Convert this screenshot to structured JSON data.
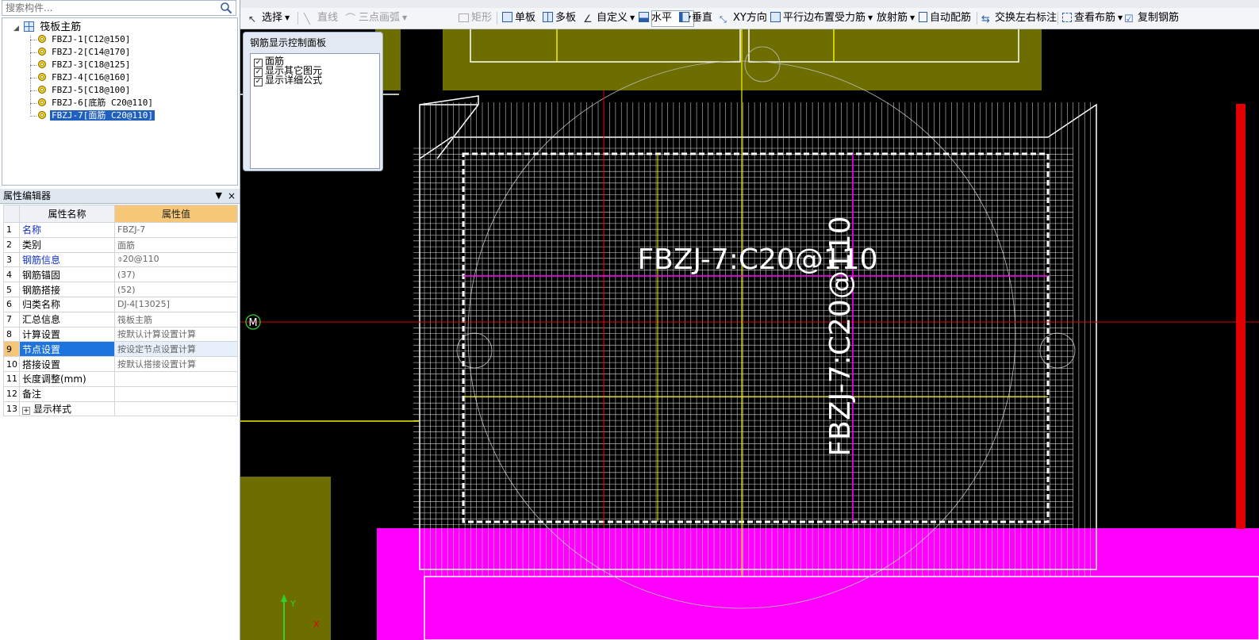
{
  "search": {
    "placeholder": "搜索构件..."
  },
  "tree": {
    "root": "筏板主筋",
    "items": [
      {
        "label": "FBZJ-1[C12@150]"
      },
      {
        "label": "FBZJ-2[C14@170]"
      },
      {
        "label": "FBZJ-3[C18@125]"
      },
      {
        "label": "FBZJ-4[C16@160]"
      },
      {
        "label": "FBZJ-5[C18@100]"
      },
      {
        "label": "FBZJ-6[底筋 C20@110]"
      },
      {
        "label": "FBZJ-7[面筋 C20@110]"
      }
    ],
    "selected_index": 6
  },
  "property_editor": {
    "title": "属性编辑器",
    "pin": "ᵖ",
    "close": "×",
    "col_name": "属性名称",
    "col_value": "属性值",
    "rows": [
      {
        "num": "1",
        "name": "名称",
        "value": "FBZJ-7",
        "blue": true
      },
      {
        "num": "2",
        "name": "类别",
        "value": "面筋",
        "blue": false
      },
      {
        "num": "3",
        "name": "钢筋信息",
        "value": "⌽20@110",
        "blue": true
      },
      {
        "num": "4",
        "name": "钢筋锚固",
        "value": "(37)",
        "blue": false
      },
      {
        "num": "5",
        "name": "钢筋搭接",
        "value": "(52)",
        "blue": false
      },
      {
        "num": "6",
        "name": "归类名称",
        "value": "DJ-4[13025]",
        "blue": false
      },
      {
        "num": "7",
        "name": "汇总信息",
        "value": "筏板主筋",
        "blue": false
      },
      {
        "num": "8",
        "name": "计算设置",
        "value": "按默认计算设置计算",
        "blue": false
      },
      {
        "num": "9",
        "name": "节点设置",
        "value": "按设定节点设置计算",
        "blue": false
      },
      {
        "num": "10",
        "name": "搭接设置",
        "value": "按默认搭接设置计算",
        "blue": false
      },
      {
        "num": "11",
        "name": "长度调整(mm)",
        "value": "",
        "blue": false
      },
      {
        "num": "12",
        "name": "备注",
        "value": "",
        "blue": false
      },
      {
        "num": "13",
        "name": "显示样式",
        "value": "",
        "blue": false
      }
    ],
    "active_row": 8
  },
  "toolbar": {
    "select": "选择",
    "line": "直线",
    "arc": "三点画弧",
    "rect": "矩形",
    "single": "单板",
    "multi": "多板",
    "custom": "自定义",
    "horizontal": "水平",
    "vertical": "垂直",
    "xy": "XY方向",
    "parallel": "平行边布置受力筋",
    "radial": "放射筋",
    "auto": "自动配筋",
    "swap": "交换左右标注",
    "view": "查看布筋",
    "copy": "复制钢筋"
  },
  "panel": {
    "title": "钢筋显示控制面板",
    "options": [
      {
        "label": "面筋",
        "checked": true
      },
      {
        "label": "显示其它图元",
        "checked": true
      },
      {
        "label": "显示详细公式",
        "checked": true
      }
    ]
  },
  "canvas": {
    "label_h": "FBZJ-7:C20@110",
    "label_v": "FBZJ-7:C20@110",
    "marker": "M",
    "axis_y": "Y",
    "axis_x": "X",
    "colors": {
      "background": "#000000",
      "olive": "#6e6e00",
      "magenta": "#ff00ff",
      "red": "#e00000",
      "yellow": "#f0f000",
      "white": "#ffffff"
    }
  }
}
